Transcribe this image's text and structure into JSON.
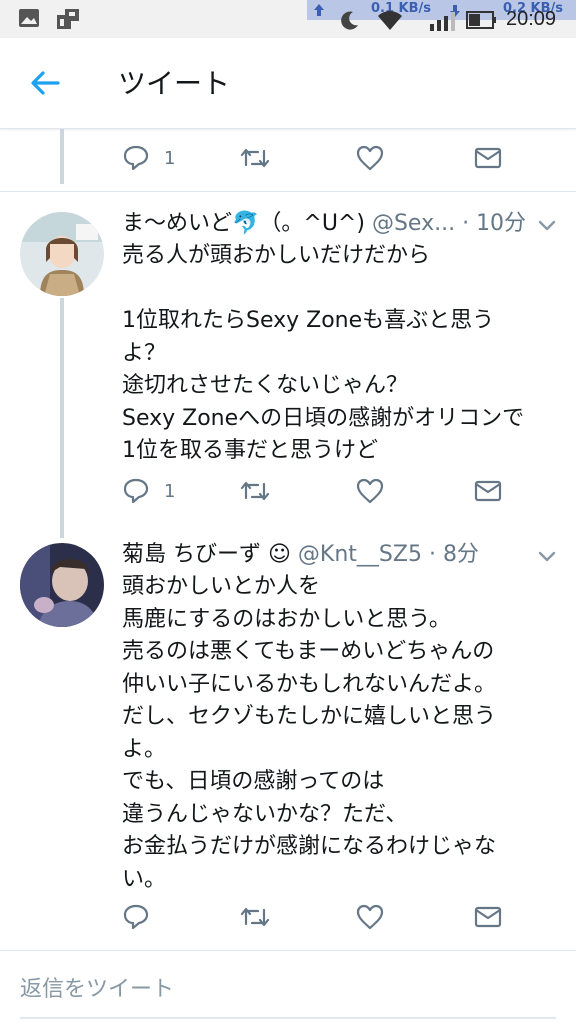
{
  "status_bar": {
    "network_up": "0.1 KB/s",
    "network_down": "0.2 KB/s",
    "time": "20:09",
    "icons": [
      "image-icon",
      "app-icon",
      "upload-arrow-icon",
      "moon-icon",
      "wifi-icon",
      "download-arrow-icon",
      "signal-icon",
      "battery-icon"
    ]
  },
  "header": {
    "back_icon": "back-arrow-icon",
    "title": "ツイート"
  },
  "top_actions": {
    "reply_count": "1"
  },
  "tweets": [
    {
      "name": "ま〜めいど🐬（。^U^)",
      "handle": "@Sex...",
      "time": "· 10分",
      "lines": [
        "売る人が頭おかしいだけだから",
        "",
        "1位取れたらSexy Zoneも喜ぶと思う",
        "よ？",
        "途切れさせたくないじゃん？",
        "Sexy Zoneへの日頃の感謝がオリコンで",
        "1位を取る事だと思うけど"
      ],
      "reply_count": "1"
    },
    {
      "name": "菊島 ちびーず ☺",
      "handle": "@Knt__SZ5",
      "time": "· 8分",
      "lines": [
        "頭おかしいとか人を",
        "馬鹿にするのはおかしいと思う。",
        "売るのは悪くてもまーめいどちゃんの",
        "仲いい子にいるかもしれないんだよ。",
        "だし、セクゾもたしかに嬉しいと思う",
        "よ。",
        "でも、日頃の感謝ってのは",
        "違うんじゃないかな？ただ、",
        "お金払うだけが感謝になるわけじゃな",
        "い。"
      ],
      "reply_count": ""
    }
  ],
  "reply_box": {
    "placeholder": "返信をツイート"
  },
  "colors": {
    "accent": "#1da1f2",
    "icon_gray": "#657786",
    "text": "#14171a"
  }
}
